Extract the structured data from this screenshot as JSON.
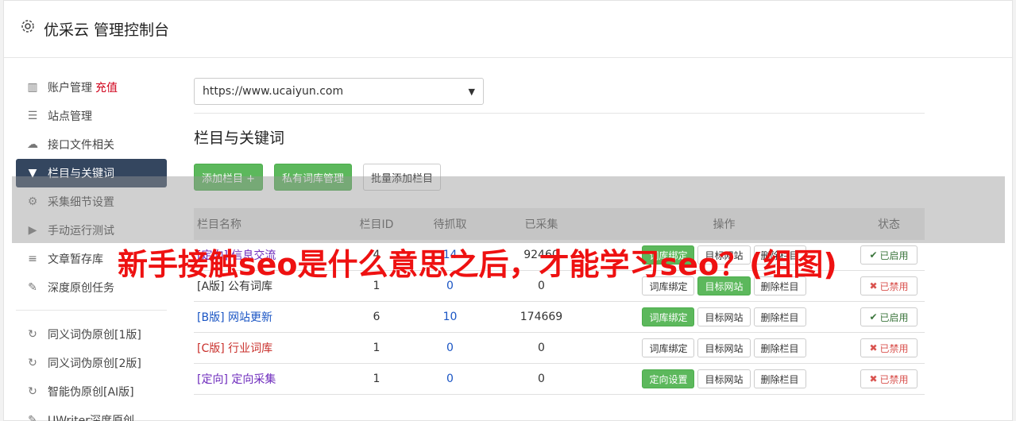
{
  "app": {
    "title": "优采云 管理控制台",
    "icon": "gear-icon"
  },
  "sidebar": {
    "items": [
      {
        "label": "账户管理",
        "extra": "充值",
        "icon": "bar-chart-icon"
      },
      {
        "label": "站点管理",
        "icon": "server-icon"
      },
      {
        "label": "接口文件相关",
        "icon": "cloud-upload-icon"
      },
      {
        "label": "栏目与关键词",
        "icon": "filter-icon",
        "active": true
      },
      {
        "label": "采集细节设置",
        "icon": "cogs-icon"
      },
      {
        "label": "手动运行测试",
        "icon": "play-circle-icon"
      },
      {
        "label": "文章暂存库",
        "icon": "database-icon"
      },
      {
        "label": "深度原创任务",
        "icon": "edit-icon"
      }
    ],
    "items2": [
      {
        "label": "同义词伪原创[1版]",
        "icon": "refresh-icon"
      },
      {
        "label": "同义词伪原创[2版]",
        "icon": "refresh-icon"
      },
      {
        "label": "智能伪原创[AI版]",
        "icon": "refresh-icon"
      },
      {
        "label": "UWriter深度原创",
        "icon": "edit-icon"
      }
    ]
  },
  "main": {
    "site_select": "https://www.ucaiyun.com",
    "section_title": "栏目与关键词",
    "buttons": {
      "add": "添加栏目 +",
      "private": "私有词库管理",
      "batch": "批量添加栏目"
    }
  },
  "table": {
    "headers": {
      "name": "栏目名称",
      "id": "栏目ID",
      "wait": "待抓取",
      "done": "已采集",
      "ops": "操作",
      "status": "状态"
    },
    "rows": [
      {
        "name": "[定向] 信息交流",
        "id": "4",
        "wait": "14",
        "done": "92460",
        "op1": "词库绑定",
        "op2": "目标网站",
        "op3": "删除栏目",
        "status": "已启用"
      },
      {
        "name": "[A版] 公有词库",
        "id": "1",
        "wait": "0",
        "done": "0",
        "op1": "词库绑定",
        "op2": "目标网站",
        "op3": "删除栏目",
        "status": "已禁用"
      },
      {
        "name": "[B版] 网站更新",
        "id": "6",
        "wait": "10",
        "done": "174669",
        "op1": "词库绑定",
        "op2": "目标网站",
        "op3": "删除栏目",
        "status": "已启用"
      },
      {
        "name": "[C版] 行业词库",
        "id": "1",
        "wait": "0",
        "done": "0",
        "op1": "词库绑定",
        "op2": "目标网站",
        "op3": "删除栏目",
        "status": "已禁用"
      },
      {
        "name": "[定向] 定向采集",
        "id": "1",
        "wait": "0",
        "done": "0",
        "op1": "定向设置",
        "op2": "目标网站",
        "op3": "删除栏目",
        "status": "已禁用"
      }
    ]
  },
  "overlay": {
    "headline": "新手接触seo是什么意思之后，才能学习seo？(组图)"
  }
}
